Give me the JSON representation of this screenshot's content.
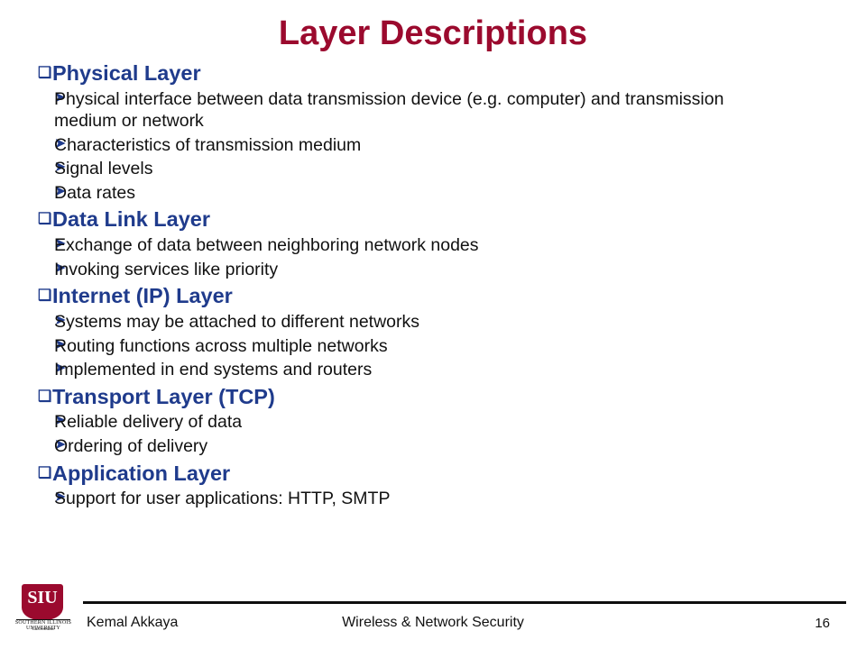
{
  "slide": {
    "title": "Layer Descriptions",
    "bullets": [
      {
        "level": 1,
        "marker": "❑",
        "text": "Physical Layer"
      },
      {
        "level": 2,
        "marker": "➤",
        "text": "Physical interface between data transmission device (e.g. computer) and transmission medium or network"
      },
      {
        "level": 2,
        "marker": "➤",
        "text": "Characteristics of transmission medium"
      },
      {
        "level": 2,
        "marker": "➤",
        "text": "Signal levels"
      },
      {
        "level": 2,
        "marker": "➤",
        "text": "Data rates"
      },
      {
        "level": 1,
        "marker": "❑",
        "text": "Data Link Layer"
      },
      {
        "level": 2,
        "marker": "➤",
        "text": "Exchange of data between neighboring network nodes"
      },
      {
        "level": 2,
        "marker": "➤",
        "text": "Invoking services like priority"
      },
      {
        "level": 1,
        "marker": "❑",
        "text": "Internet (IP) Layer"
      },
      {
        "level": 2,
        "marker": "➤",
        "text": "Systems may be attached to different networks"
      },
      {
        "level": 2,
        "marker": "➤",
        "text": "Routing functions across multiple networks"
      },
      {
        "level": 2,
        "marker": "➤",
        "text": "Implemented in end systems and routers"
      },
      {
        "level": 1,
        "marker": "❑",
        "text": "Transport Layer (TCP)"
      },
      {
        "level": 2,
        "marker": "➤",
        "text": "Reliable delivery of data"
      },
      {
        "level": 2,
        "marker": "➤",
        "text": "Ordering of delivery"
      },
      {
        "level": 1,
        "marker": "❑",
        "text": "Application Layer"
      },
      {
        "level": 2,
        "marker": "➤",
        "text": "Support for user applications: HTTP, SMTP"
      }
    ]
  },
  "footer": {
    "author": "Kemal Akkaya",
    "course": "Wireless & Network Security",
    "page_number": "16"
  },
  "logo": {
    "mark": "SIU",
    "top_text": "SOUTHERN ILLINOIS UNIVERSITY",
    "bottom_text": "Carbondale"
  },
  "colors": {
    "title": "#9B0A2E",
    "level1": "#1F3B8C",
    "level2": "#111111"
  }
}
